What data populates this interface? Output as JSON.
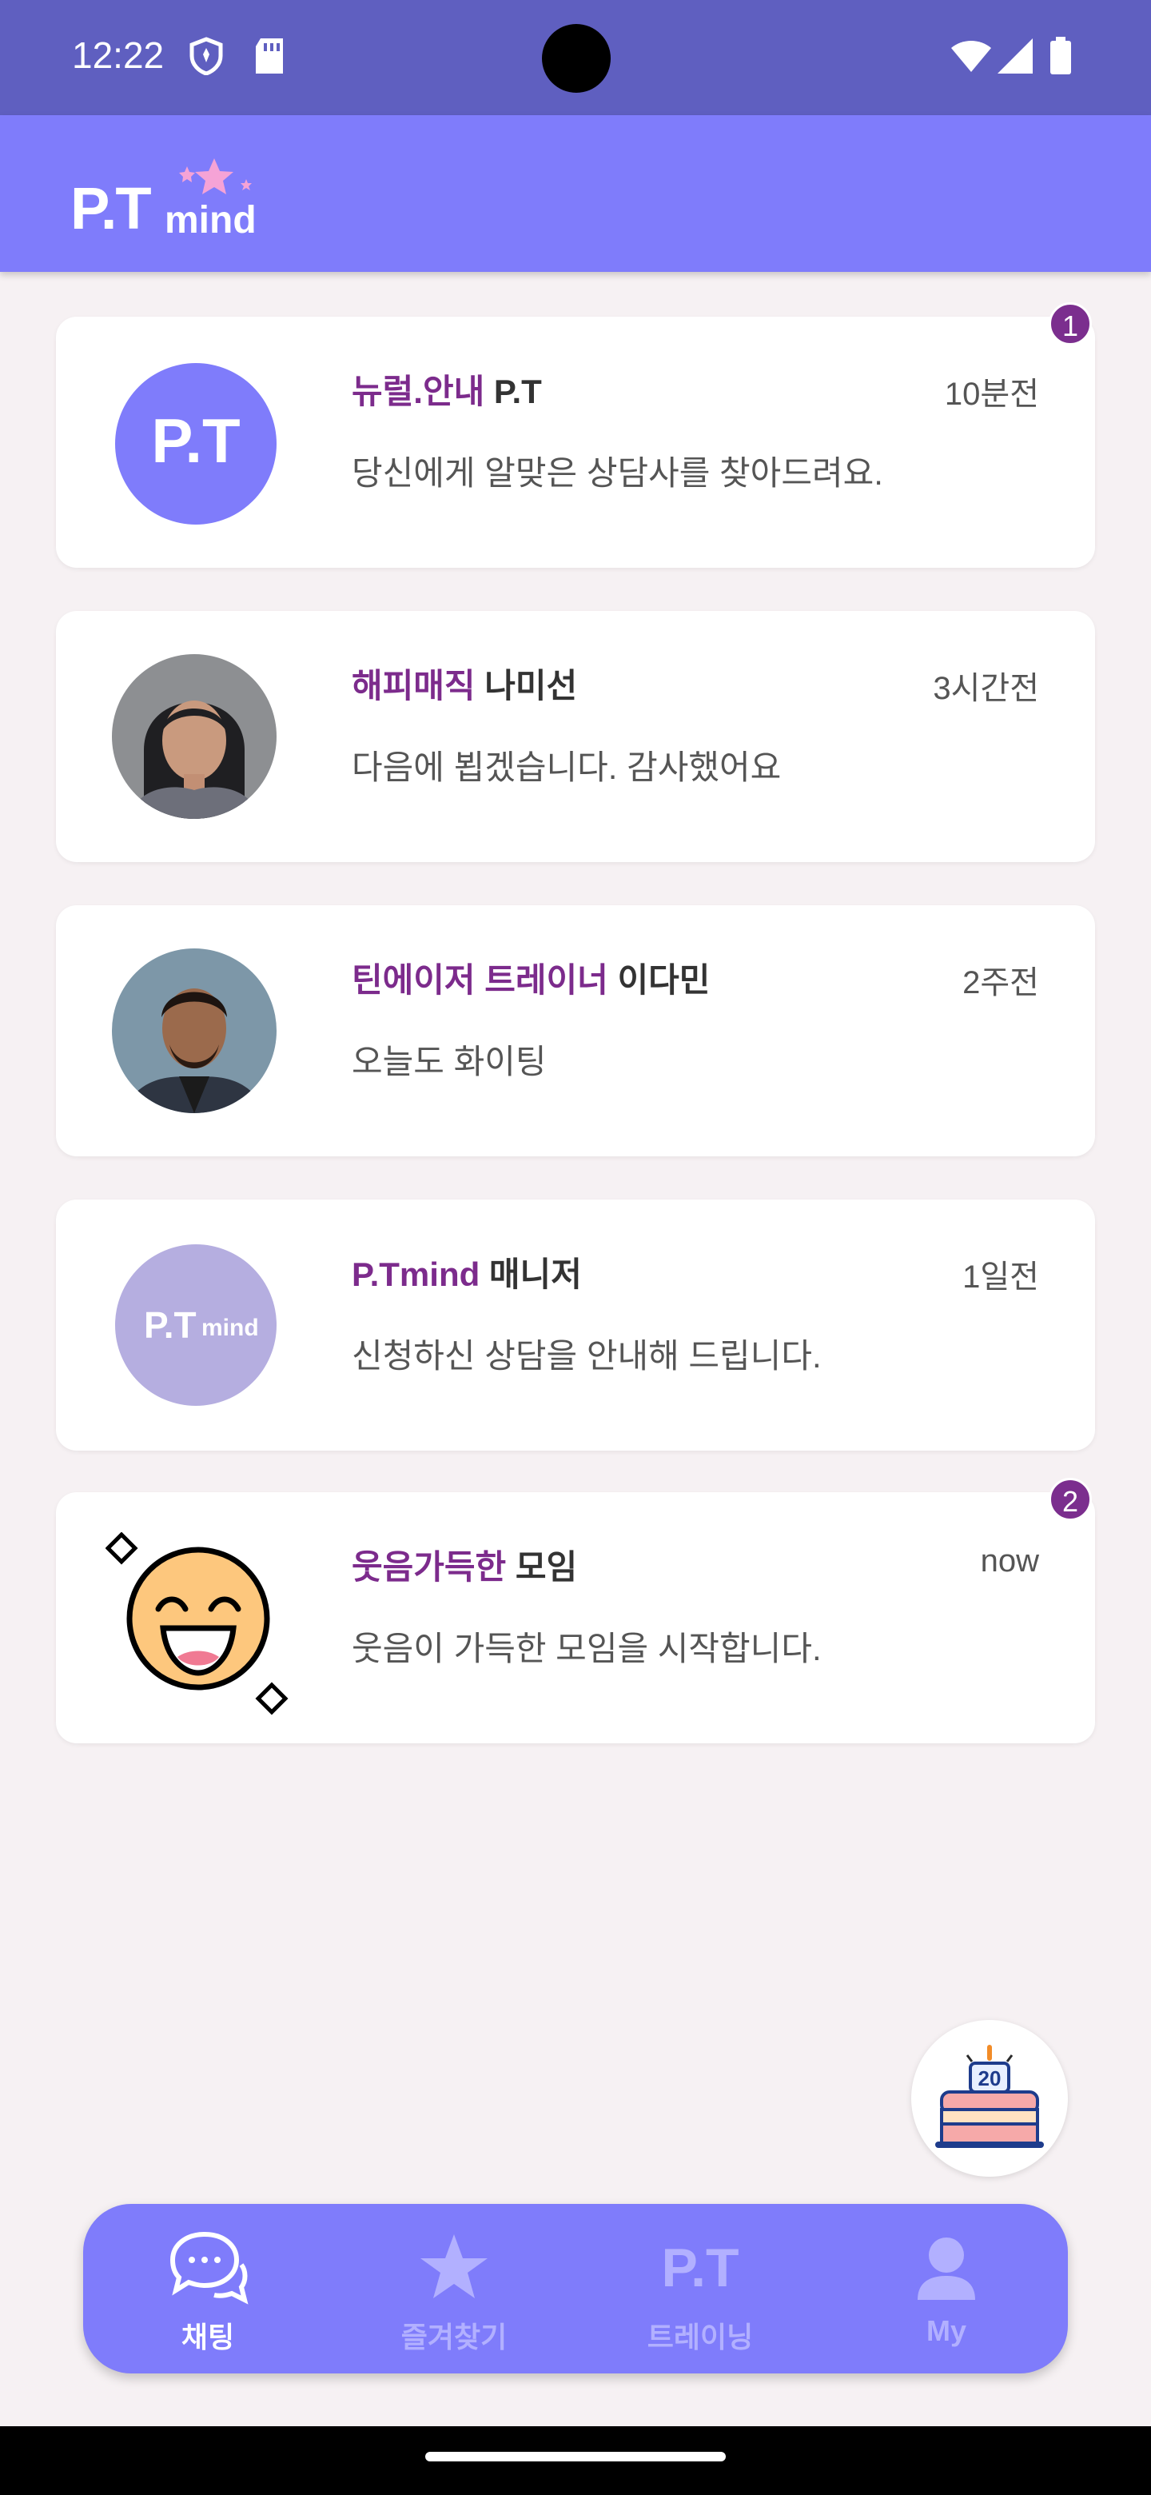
{
  "status_bar": {
    "time": "12:22",
    "icons": [
      "shield-icon",
      "sd-card-icon",
      "wifi-icon",
      "signal-icon",
      "battery-icon"
    ]
  },
  "header": {
    "logo_main": "P.T",
    "logo_sub": "mind"
  },
  "chats": [
    {
      "highlight": "뉴럴.안내",
      "name": " P.T",
      "time": "10분전",
      "message": "당신에게 알맞은 상담사를 찾아드려요.",
      "badge": "1",
      "avatar_text": "P.T"
    },
    {
      "highlight": "해피매직",
      "name": " 나미선",
      "time": "3시간전",
      "message": "다음에 뵙겠습니다. 감사했어요",
      "badge": null
    },
    {
      "highlight": "틴에이저 트레이너",
      "name": " 이다민",
      "time": "2주전",
      "message": "오늘도 화이팅",
      "badge": null
    },
    {
      "highlight": "P.Tmind",
      "name": " 매니저",
      "time": "1일전",
      "message": "신청하신 상담을 안내해 드립니다.",
      "badge": null,
      "avatar_text": "P.T",
      "avatar_sub": "mind"
    },
    {
      "highlight": "웃음가득한",
      "name": " 모임",
      "time": "now",
      "message": "웃음이 가득한 모임을 시작합니다.",
      "badge": "2"
    }
  ],
  "fab": {
    "icon": "birthday-cake-icon",
    "number": "20"
  },
  "nav": [
    {
      "label": "채팅",
      "icon": "chat-bubbles-icon",
      "active": true
    },
    {
      "label": "즐겨찾기",
      "icon": "star-icon",
      "active": false
    },
    {
      "label": "트레이닝",
      "icon": "pt-icon",
      "icon_text": "P.T",
      "active": false
    },
    {
      "label": "My",
      "icon": "person-icon",
      "active": false
    }
  ],
  "colors": {
    "status_bar": "#5f5fc0",
    "header": "#7f7cfb",
    "accent_purple": "#7c2b8c",
    "background": "#f6f1f3"
  }
}
